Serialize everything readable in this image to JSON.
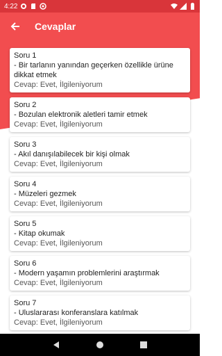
{
  "status": {
    "time": "4:22"
  },
  "appbar": {
    "title": "Cevaplar"
  },
  "cards": [
    {
      "title": "Soru 1",
      "question": "- Bir tarlanın yanından geçerken özellikle ürüne dikkat etmek",
      "answer": "Cevap: Evet, İlgileniyorum"
    },
    {
      "title": "Soru 2",
      "question": "- Bozulan elektronik aletleri tamir etmek",
      "answer": "Cevap: Evet, İlgileniyorum"
    },
    {
      "title": "Soru 3",
      "question": "- Akıl danışılabilecek bir kişi olmak",
      "answer": "Cevap: Evet, İlgileniyorum"
    },
    {
      "title": "Soru 4",
      "question": "- Müzeleri gezmek",
      "answer": "Cevap: Evet, İlgileniyorum"
    },
    {
      "title": "Soru 5",
      "question": "- Kitap okumak",
      "answer": "Cevap: Evet, İlgileniyorum"
    },
    {
      "title": "Soru 6",
      "question": "- Modern yaşamın problemlerini araştırmak",
      "answer": "Cevap: Evet, İlgileniyorum"
    },
    {
      "title": "Soru 7",
      "question": "- Uluslararası konferanslara katılmak",
      "answer": "Cevap: Evet, İlgileniyorum"
    }
  ],
  "colors": {
    "primary": "#f24d4f",
    "status_bar": "#d9353a"
  }
}
